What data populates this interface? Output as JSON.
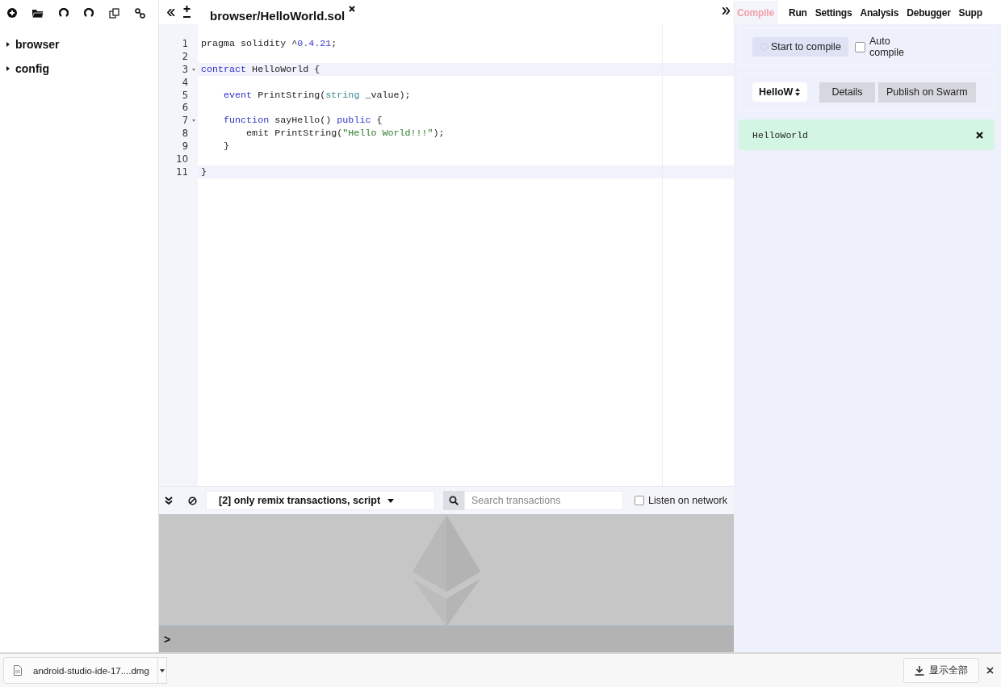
{
  "file_tree": [
    {
      "label": "browser",
      "expanded": false
    },
    {
      "label": "config",
      "expanded": false
    }
  ],
  "editor": {
    "tabs": [
      {
        "label": "browser/HelloWorld.sol",
        "selected": true
      }
    ],
    "lines": [
      {
        "number": "1",
        "foldable": false,
        "highlighted": false,
        "segments": [
          {
            "kind": "plain",
            "text": "pragma solidity ^"
          },
          {
            "kind": "number",
            "text": "0.4.21"
          },
          {
            "kind": "plain",
            "text": ";"
          }
        ]
      },
      {
        "number": "2",
        "foldable": false,
        "highlighted": false
      },
      {
        "number": "3",
        "foldable": true,
        "highlighted": true,
        "segments": [
          {
            "kind": "keyword",
            "text": "contract"
          },
          {
            "kind": "plain",
            "text": " HelloWorld {"
          }
        ]
      },
      {
        "number": "4",
        "foldable": false,
        "highlighted": false
      },
      {
        "number": "5",
        "foldable": false,
        "highlighted": false,
        "segments": [
          {
            "kind": "keyword",
            "text": "    event"
          },
          {
            "kind": "plain",
            "text": " PrintString("
          },
          {
            "kind": "type",
            "text": "string"
          },
          {
            "kind": "plain",
            "text": " _value);"
          }
        ]
      },
      {
        "number": "6",
        "foldable": false,
        "highlighted": false
      },
      {
        "number": "7",
        "foldable": true,
        "highlighted": false,
        "segments": [
          {
            "kind": "keyword",
            "text": "    function"
          },
          {
            "kind": "plain",
            "text": " sayHello() "
          },
          {
            "kind": "keyword",
            "text": "public"
          },
          {
            "kind": "plain",
            "text": " {"
          }
        ]
      },
      {
        "number": "8",
        "foldable": false,
        "highlighted": false,
        "segments": [
          {
            "kind": "plain",
            "text": "        emit PrintString("
          },
          {
            "kind": "string",
            "text": "\"Hello World!!!\""
          },
          {
            "kind": "plain",
            "text": ");"
          }
        ]
      },
      {
        "number": "9",
        "foldable": false,
        "highlighted": false,
        "segments": [
          {
            "kind": "plain",
            "text": "    }"
          }
        ]
      },
      {
        "number": "10",
        "foldable": false,
        "highlighted": false
      },
      {
        "number": "11",
        "foldable": false,
        "highlighted": true,
        "segments": [
          {
            "kind": "plain",
            "text": "}"
          }
        ]
      }
    ]
  },
  "right_tabs": [
    {
      "label": "Compile",
      "selected": true
    },
    {
      "label": "Run",
      "selected": false
    },
    {
      "label": "Settings",
      "selected": false
    },
    {
      "label": "Analysis",
      "selected": false
    },
    {
      "label": "Debugger",
      "selected": false
    },
    {
      "label": "Supp",
      "selected": false
    }
  ],
  "compile": {
    "start_button": "Start to compile",
    "auto_compile": {
      "label": "Auto compile",
      "checked": false
    },
    "contract_select": "HelloW",
    "details_button": "Details",
    "publish_button": "Publish on Swarm",
    "result": "HelloWorld"
  },
  "terminal": {
    "filter": "[2] only remix transactions, script",
    "search": {
      "placeholder": "Search transactions"
    },
    "listen": {
      "label": "Listen on network",
      "checked": false
    },
    "prompt": ">"
  },
  "download_bar": {
    "file": "android-studio-ide-17....dmg",
    "show_all": "显示全部"
  }
}
